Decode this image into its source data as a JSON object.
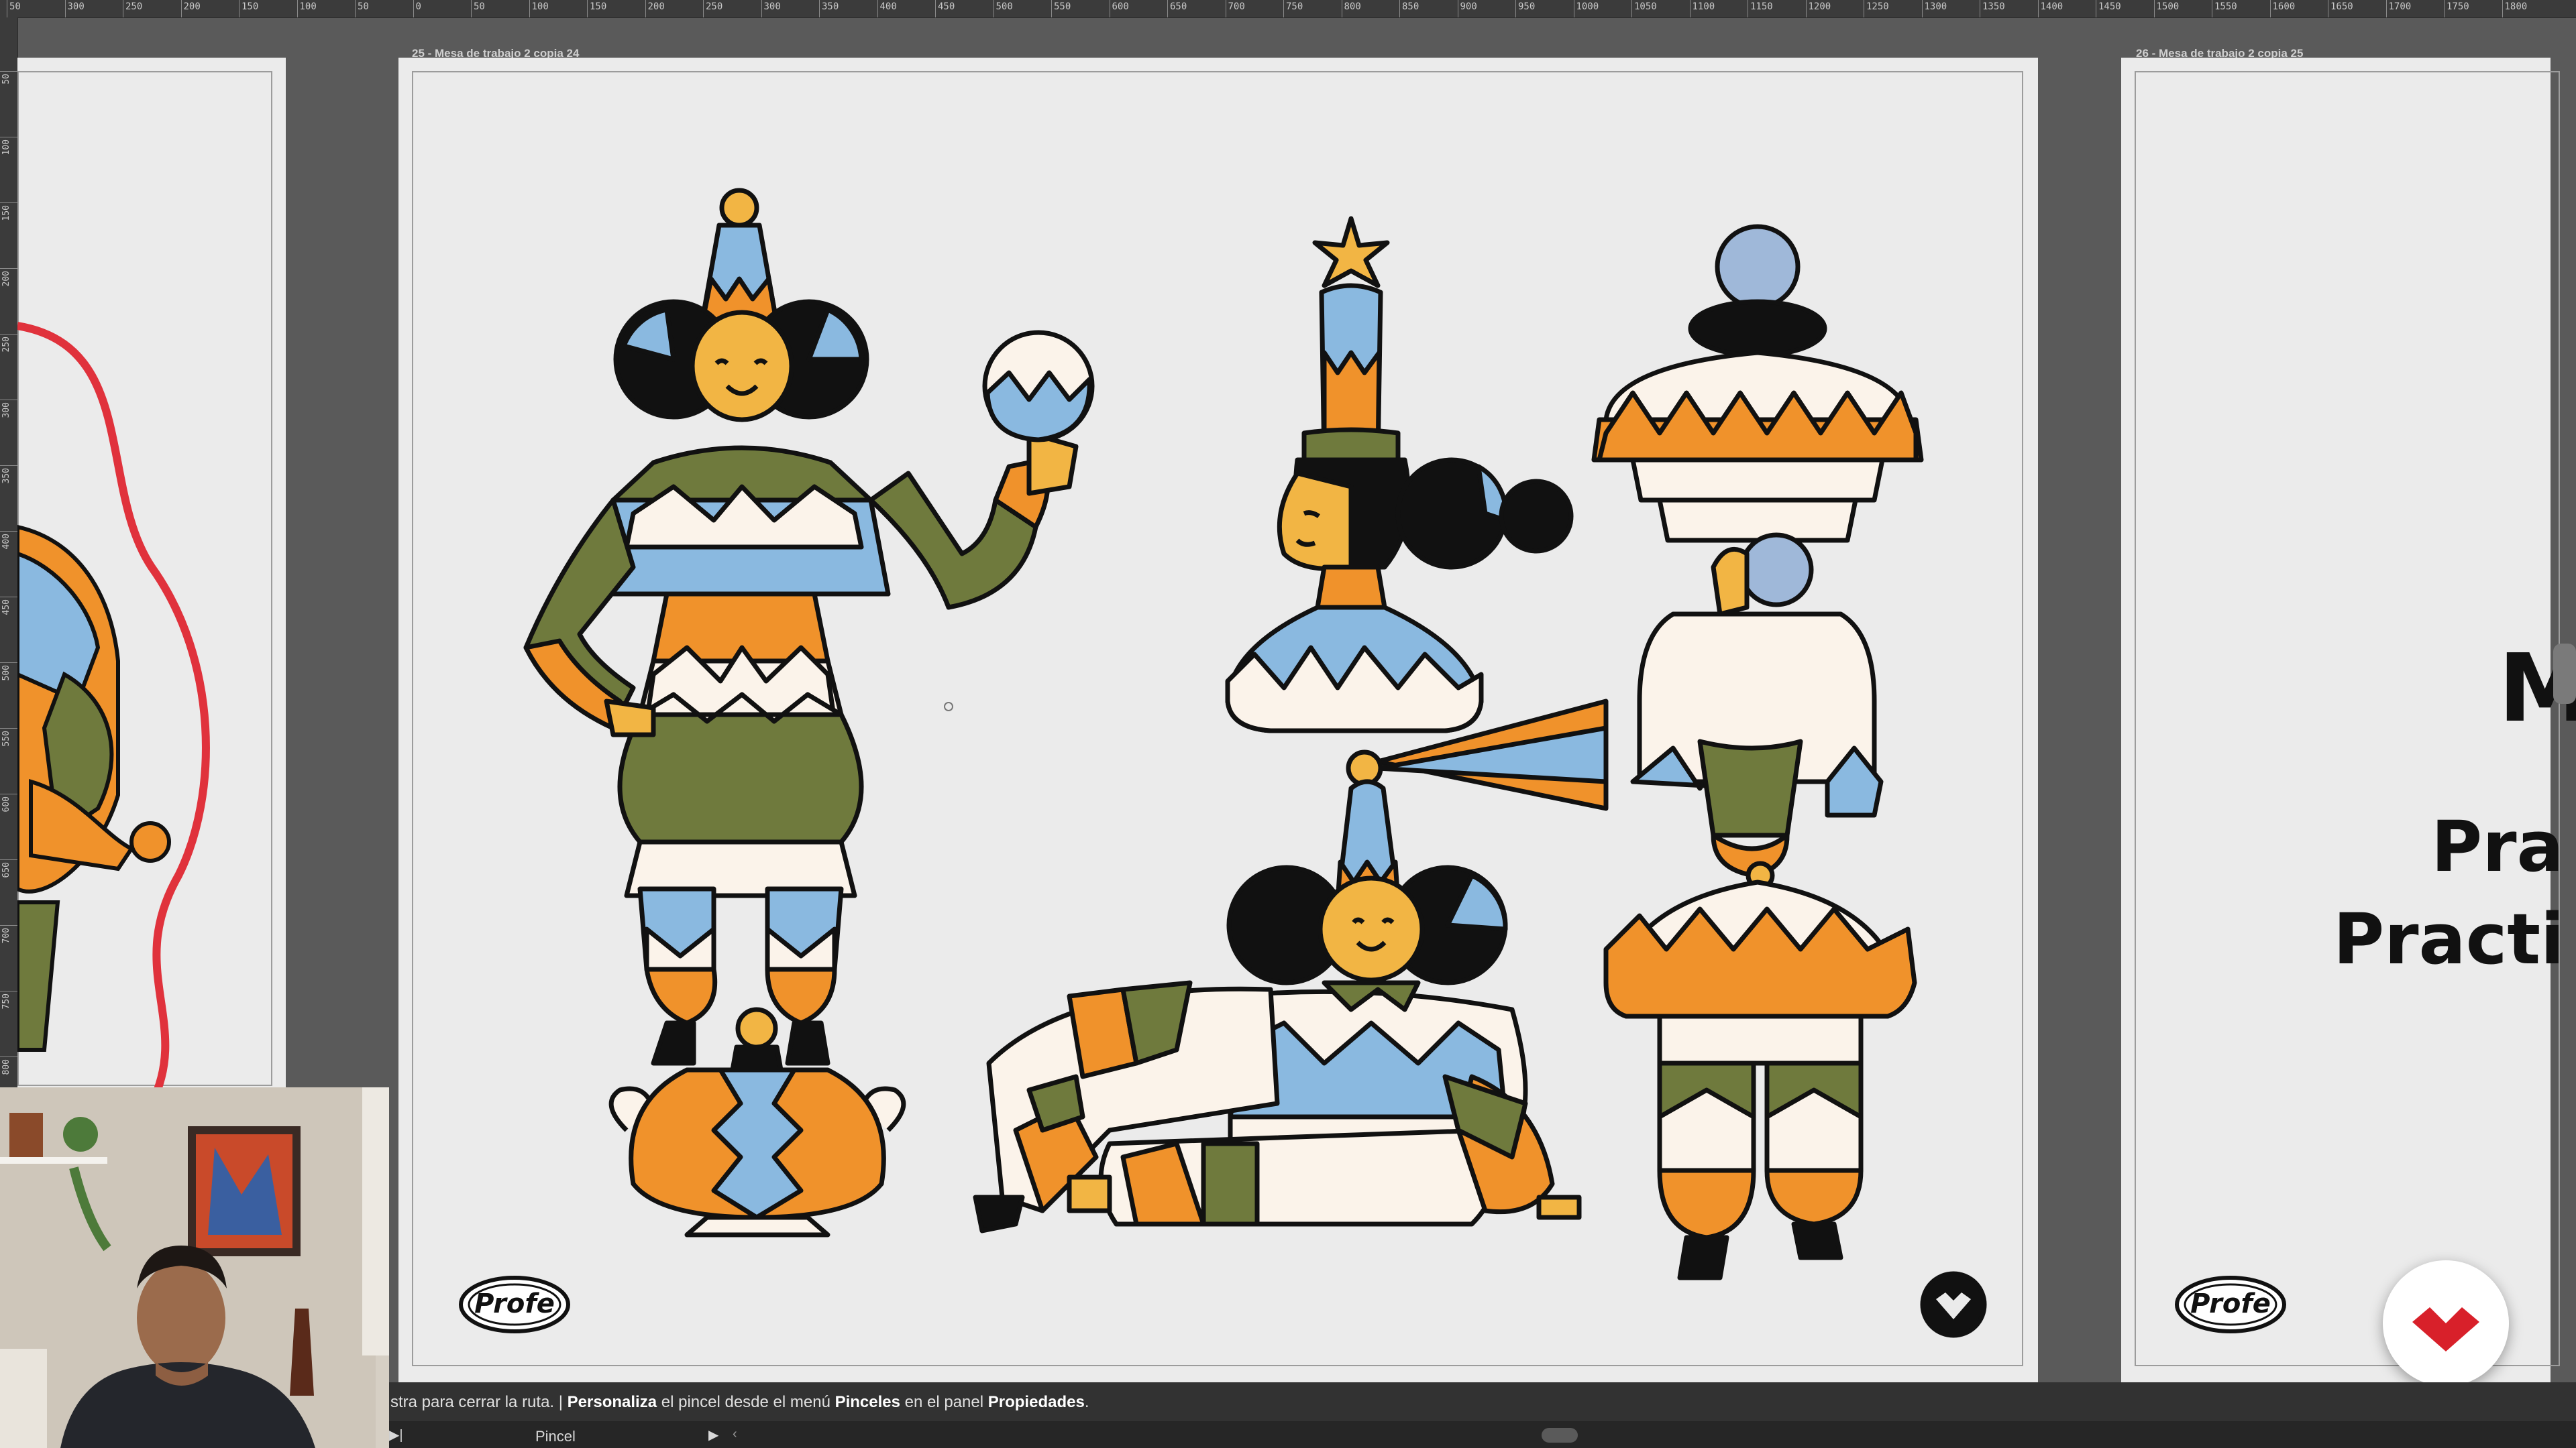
{
  "ruler": {
    "top_labels": [
      "50",
      "300",
      "250",
      "200",
      "150",
      "100",
      "50",
      "0",
      "50",
      "100",
      "150",
      "200",
      "250",
      "300",
      "350",
      "400",
      "450",
      "500",
      "550",
      "600",
      "650",
      "700",
      "750",
      "800",
      "850",
      "900",
      "950",
      "1000",
      "1050",
      "1100",
      "1150",
      "1200",
      "1250",
      "1300",
      "1350",
      "1400",
      "1450",
      "1500",
      "1550",
      "1600",
      "1650",
      "1700",
      "1750",
      "1800"
    ],
    "left_labels": [
      "50",
      "100",
      "150",
      "200",
      "250",
      "300",
      "350",
      "400",
      "450",
      "500",
      "550",
      "600",
      "650",
      "700",
      "750",
      "800"
    ]
  },
  "artboards": {
    "main_label": "25 - Mesa de trabajo 2 copia 24",
    "right_label": "26 - Mesa de trabajo 2 copia 25"
  },
  "logos": {
    "profe_text": "Profe"
  },
  "right_artboard_text": {
    "heading_partial": "M",
    "line1_partial": "Pra",
    "line2_partial": "Practi"
  },
  "status_bar": {
    "prefix": "stra para cerrar la ruta.  |  ",
    "bold1": "Personaliza",
    "mid": " el pincel desde el menú ",
    "bold2": "Pinceles",
    "mid2": " en el panel ",
    "bold3": "Propiedades",
    "suffix": "."
  },
  "bottom_bar": {
    "tool_name": "Pincel"
  },
  "colors": {
    "orange": "#f0922b",
    "blue": "#8ab9e0",
    "olive": "#6f7a3d",
    "cream": "#fbf3ea",
    "black": "#111111",
    "skin": "#f2b544",
    "red_path": "#e0323c",
    "brand_red": "#d8202a"
  }
}
